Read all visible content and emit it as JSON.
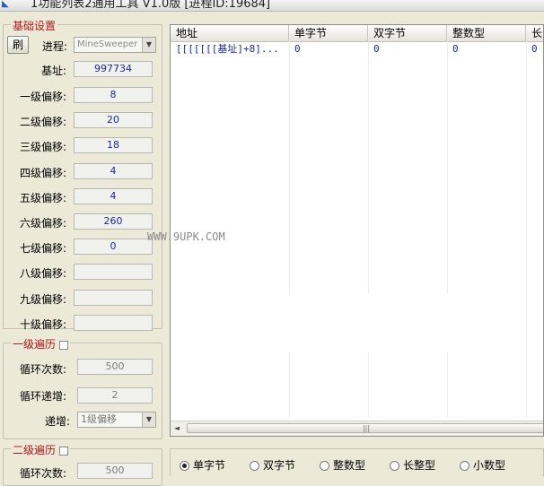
{
  "window": {
    "title": "1功能列表2通用工具 V1.0版  [进程ID:19684]"
  },
  "basic_settings": {
    "title": "基础设置",
    "refresh_label": "刷",
    "process_label": "进程:",
    "process_value": "MineSweeper",
    "base_label": "基址:",
    "base_value": "997734",
    "offsets": [
      {
        "label": "一级偏移:",
        "value": "8"
      },
      {
        "label": "二级偏移:",
        "value": "20"
      },
      {
        "label": "三级偏移:",
        "value": "18"
      },
      {
        "label": "四级偏移:",
        "value": "4"
      },
      {
        "label": "五级偏移:",
        "value": "4"
      },
      {
        "label": "六级偏移:",
        "value": "260"
      },
      {
        "label": "七级偏移:",
        "value": "0"
      },
      {
        "label": "八级偏移:",
        "value": ""
      },
      {
        "label": "九级偏移:",
        "value": ""
      },
      {
        "label": "十级偏移:",
        "value": ""
      }
    ]
  },
  "traverse1": {
    "title": "一级遍历",
    "loop_label": "循环次数:",
    "loop_value": "500",
    "step_label": "循环递增:",
    "step_value": "2",
    "inc_label": "递增:",
    "inc_value": "1级偏移"
  },
  "traverse2": {
    "title": "二级遍历",
    "loop_label": "循环次数:",
    "loop_value": "500"
  },
  "list": {
    "columns": [
      "地址",
      "单字节",
      "双字节",
      "整数型",
      "长"
    ],
    "rows": [
      [
        "[[[[[[[基址]+8]...",
        "0",
        "0",
        "0",
        "0"
      ]
    ]
  },
  "watermark": "WWW.9UPK.COM",
  "type_radios": [
    {
      "label": "单字节",
      "checked": true
    },
    {
      "label": "双字节",
      "checked": false
    },
    {
      "label": "整数型",
      "checked": false
    },
    {
      "label": "长整型",
      "checked": false
    },
    {
      "label": "小数型",
      "checked": false
    }
  ]
}
